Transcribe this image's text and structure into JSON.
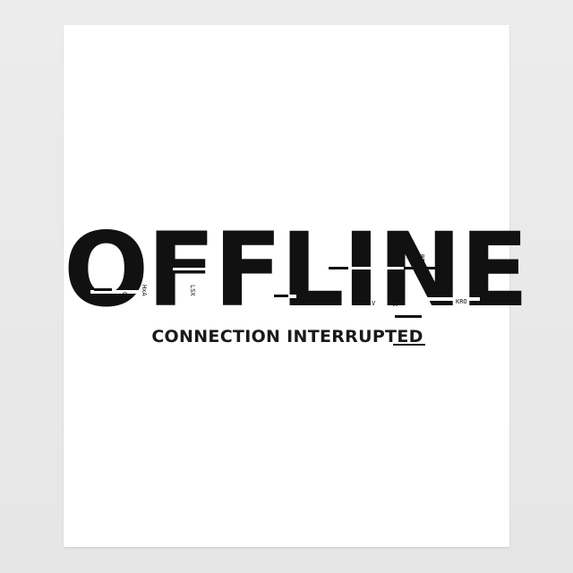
{
  "artwork": {
    "headline": "OFFLINE",
    "subtitle": "CONNECTION INTERRUPTED",
    "glitch_fragments": [
      "OC",
      "HxA",
      "bHE",
      "LSX",
      "LSX",
      "X",
      "RTYX",
      "V",
      "EX",
      "KRO"
    ],
    "colors": {
      "ink": "#111111",
      "paper": "#ffffff",
      "backdrop": "#e9e9e9"
    }
  }
}
